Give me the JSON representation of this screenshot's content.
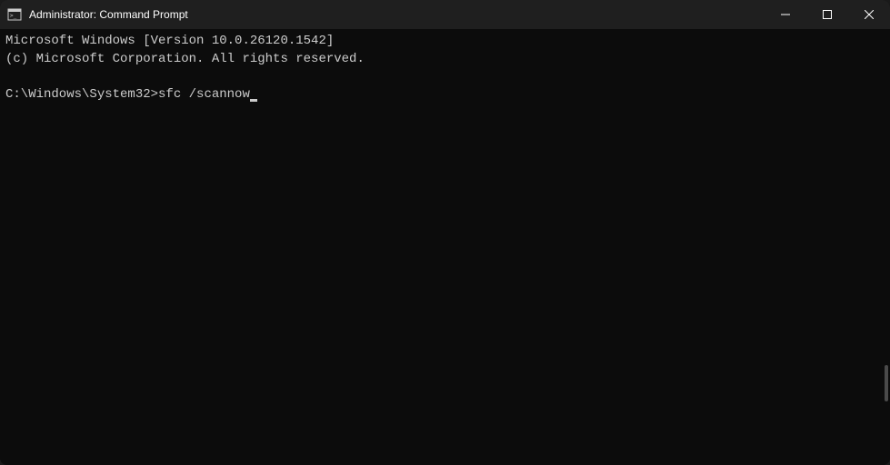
{
  "titlebar": {
    "title": "Administrator: Command Prompt"
  },
  "terminal": {
    "line1": "Microsoft Windows [Version 10.0.26120.1542]",
    "line2": "(c) Microsoft Corporation. All rights reserved.",
    "prompt": "C:\\Windows\\System32>",
    "command": "sfc /scannow"
  }
}
